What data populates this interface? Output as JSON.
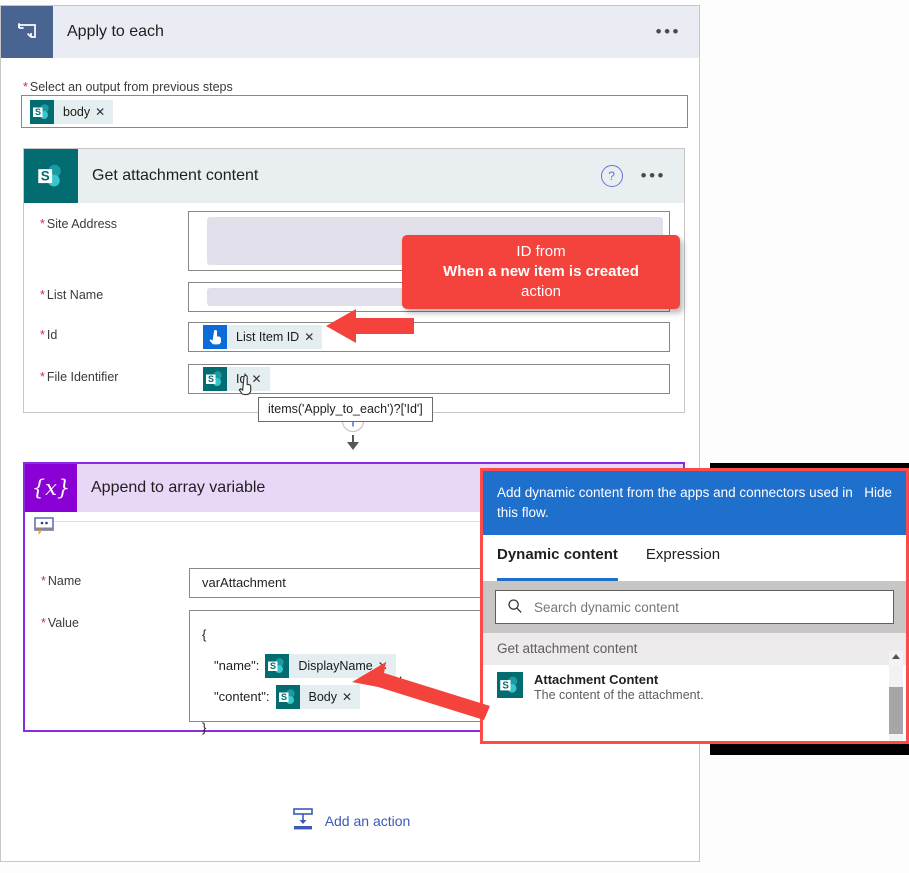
{
  "apply_to_each": {
    "title": "Apply to each",
    "icon": "loop-icon",
    "more_menu": "•••",
    "select_output_label": "Select an output from previous steps",
    "required_marker": "*",
    "output_token": {
      "label": "body",
      "icon": "sharepoint-icon",
      "remove": "✕"
    }
  },
  "get_attachment_content": {
    "title": "Get attachment content",
    "icon": "sharepoint-icon",
    "help": "?",
    "more_menu": "•••",
    "fields": [
      {
        "label": "Site Address",
        "required": true,
        "value": "",
        "redacted": true
      },
      {
        "label": "List Name",
        "required": true,
        "value": "",
        "redacted": true
      },
      {
        "label": "Id",
        "required": true,
        "token": {
          "label": "List Item ID",
          "icon": "trigger-touch-icon",
          "remove": "✕"
        }
      },
      {
        "label": "File Identifier",
        "required": true,
        "token": {
          "label": "Id",
          "icon": "sharepoint-icon",
          "remove": "✕"
        }
      }
    ]
  },
  "tooltip": {
    "text": "items('Apply_to_each')?['Id']"
  },
  "connector": {
    "add_icon": "plus-icon",
    "arrow": "down-arrow-icon"
  },
  "append_to_array": {
    "title": "Append to array variable",
    "icon": "variable-braces-icon",
    "comment_icon": "comment-icon",
    "fields": {
      "name": {
        "label": "Name",
        "required": true,
        "value": "varAttachment"
      },
      "value": {
        "label": "Value",
        "required": true,
        "lines": {
          "open_brace": "{",
          "name_key": "\"name\":",
          "name_token": {
            "label": "DisplayName",
            "icon": "sharepoint-icon",
            "remove": "✕"
          },
          "name_comma": ",",
          "content_key": "\"content\":",
          "content_token": {
            "label": "Body",
            "icon": "sharepoint-icon",
            "remove": "✕"
          },
          "close_brace": "}"
        }
      }
    }
  },
  "add_action": {
    "label": "Add an action",
    "icon": "insert-action-icon"
  },
  "dynamic_content_panel": {
    "banner_text": "Add dynamic content from the apps and connectors used in this flow.",
    "hide_label": "Hide",
    "tabs": [
      {
        "label": "Dynamic content",
        "active": true
      },
      {
        "label": "Expression",
        "active": false
      }
    ],
    "search": {
      "placeholder": "Search dynamic content",
      "icon": "search-icon",
      "value": ""
    },
    "group_header": "Get attachment content",
    "items": [
      {
        "name": "Attachment Content",
        "description": "The content of the attachment.",
        "icon": "sharepoint-icon"
      }
    ],
    "scrollbar": {
      "up_arrow": "scroll-up-icon"
    }
  },
  "annotations": {
    "callout_id": {
      "line1": "ID from",
      "line2": "When a new item is created",
      "line3": "action",
      "color": "#f4433c"
    },
    "arrow_to_id": "red-arrow-icon",
    "arrow_to_body": "red-arrow-icon"
  },
  "colors": {
    "apply_header": "#e9ecf3",
    "apply_icon": "#4a6491",
    "sharepoint_teal": "#036c70",
    "variable_purple": "#8a01d6",
    "panel_blue": "#1f6fcc",
    "annotation_red": "#f4433c",
    "link_blue": "#3b5ab5"
  }
}
